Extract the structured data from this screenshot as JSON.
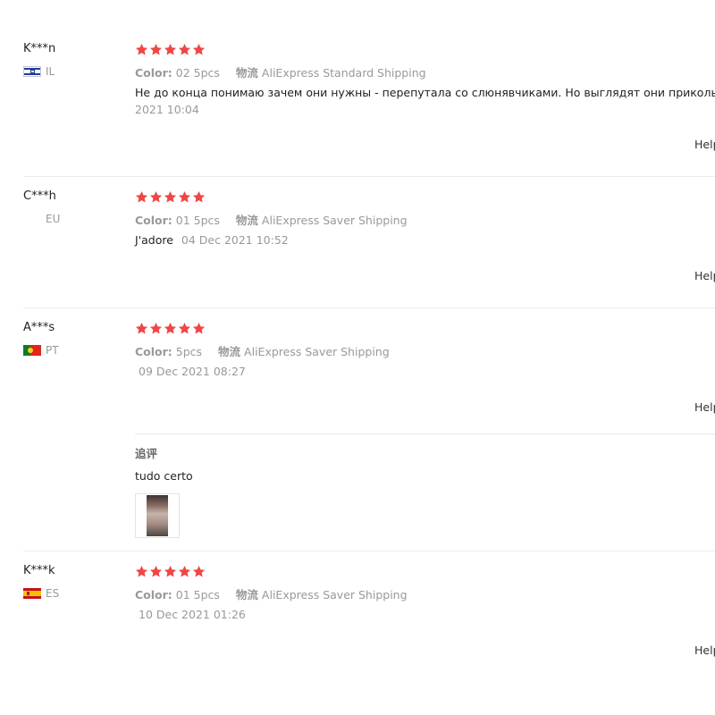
{
  "colors": {
    "star": "#f04646",
    "muted": "#999999",
    "text": "#222222",
    "divider": "#ebebeb"
  },
  "reviews": [
    {
      "user": "K***n",
      "country": "IL",
      "flag_icon": "israel-flag-icon",
      "rating": 5,
      "color_label": "Color:",
      "color_value": "02 5pcs",
      "shipping_label": "物流",
      "shipping_value": "AliExpress Standard Shipping",
      "text": "Не до конца понимаю зачем они нужны - перепутала со слюнявчиками. Но выглядят они прикольно.",
      "date": "2021 10:04",
      "helpful": "Help"
    },
    {
      "user": "C***h",
      "country": "EU",
      "flag_icon": "",
      "rating": 5,
      "color_label": "Color:",
      "color_value": "01 5pcs",
      "shipping_label": "物流",
      "shipping_value": "AliExpress Saver Shipping",
      "text": "J'adore",
      "date": "04 Dec 2021 10:52",
      "helpful": "Help"
    },
    {
      "user": "A***s",
      "country": "PT",
      "flag_icon": "portugal-flag-icon",
      "rating": 5,
      "color_label": "Color:",
      "color_value": "5pcs",
      "shipping_label": "物流",
      "shipping_value": "AliExpress Saver Shipping",
      "text": "",
      "date": "09 Dec 2021 08:27",
      "helpful": "Help",
      "followup": {
        "title": "追评",
        "text": "tudo certo",
        "image": "review-photo-thumbnail"
      }
    },
    {
      "user": "K***k",
      "country": "ES",
      "flag_icon": "spain-flag-icon",
      "rating": 5,
      "color_label": "Color:",
      "color_value": "01 5pcs",
      "shipping_label": "物流",
      "shipping_value": "AliExpress Saver Shipping",
      "text": "",
      "date": "10 Dec 2021 01:26",
      "helpful": "Help"
    }
  ]
}
